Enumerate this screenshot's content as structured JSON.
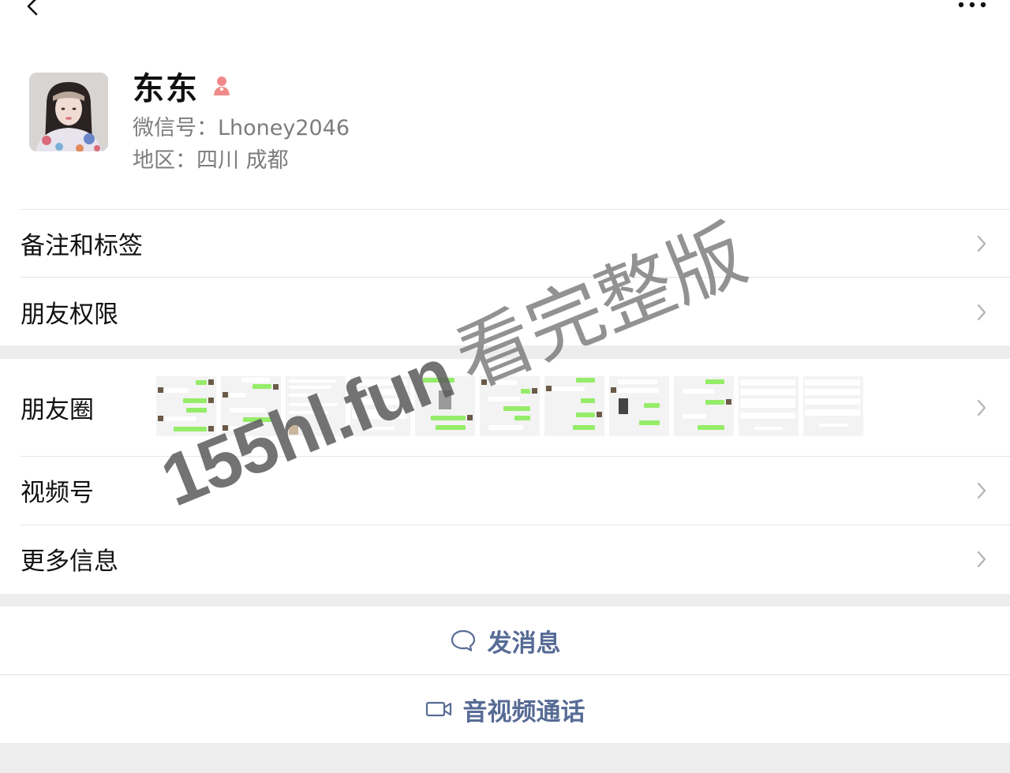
{
  "profile": {
    "name": "东东",
    "wechat_id": "微信号：Lhoney2046",
    "region": "地区：四川 成都",
    "gender_icon": "female-icon",
    "gender_color": "#fa5151"
  },
  "menu": {
    "remarks_label": "备注和标签",
    "permissions_label": "朋友权限",
    "moments_label": "朋友圈",
    "channels_label": "视频号",
    "more_info_label": "更多信息"
  },
  "actions": {
    "message_label": "发消息",
    "call_label": "音视频通话",
    "accent_color": "#576b95"
  },
  "watermark": {
    "url": "155hl.fun",
    "text": "看完整版"
  }
}
